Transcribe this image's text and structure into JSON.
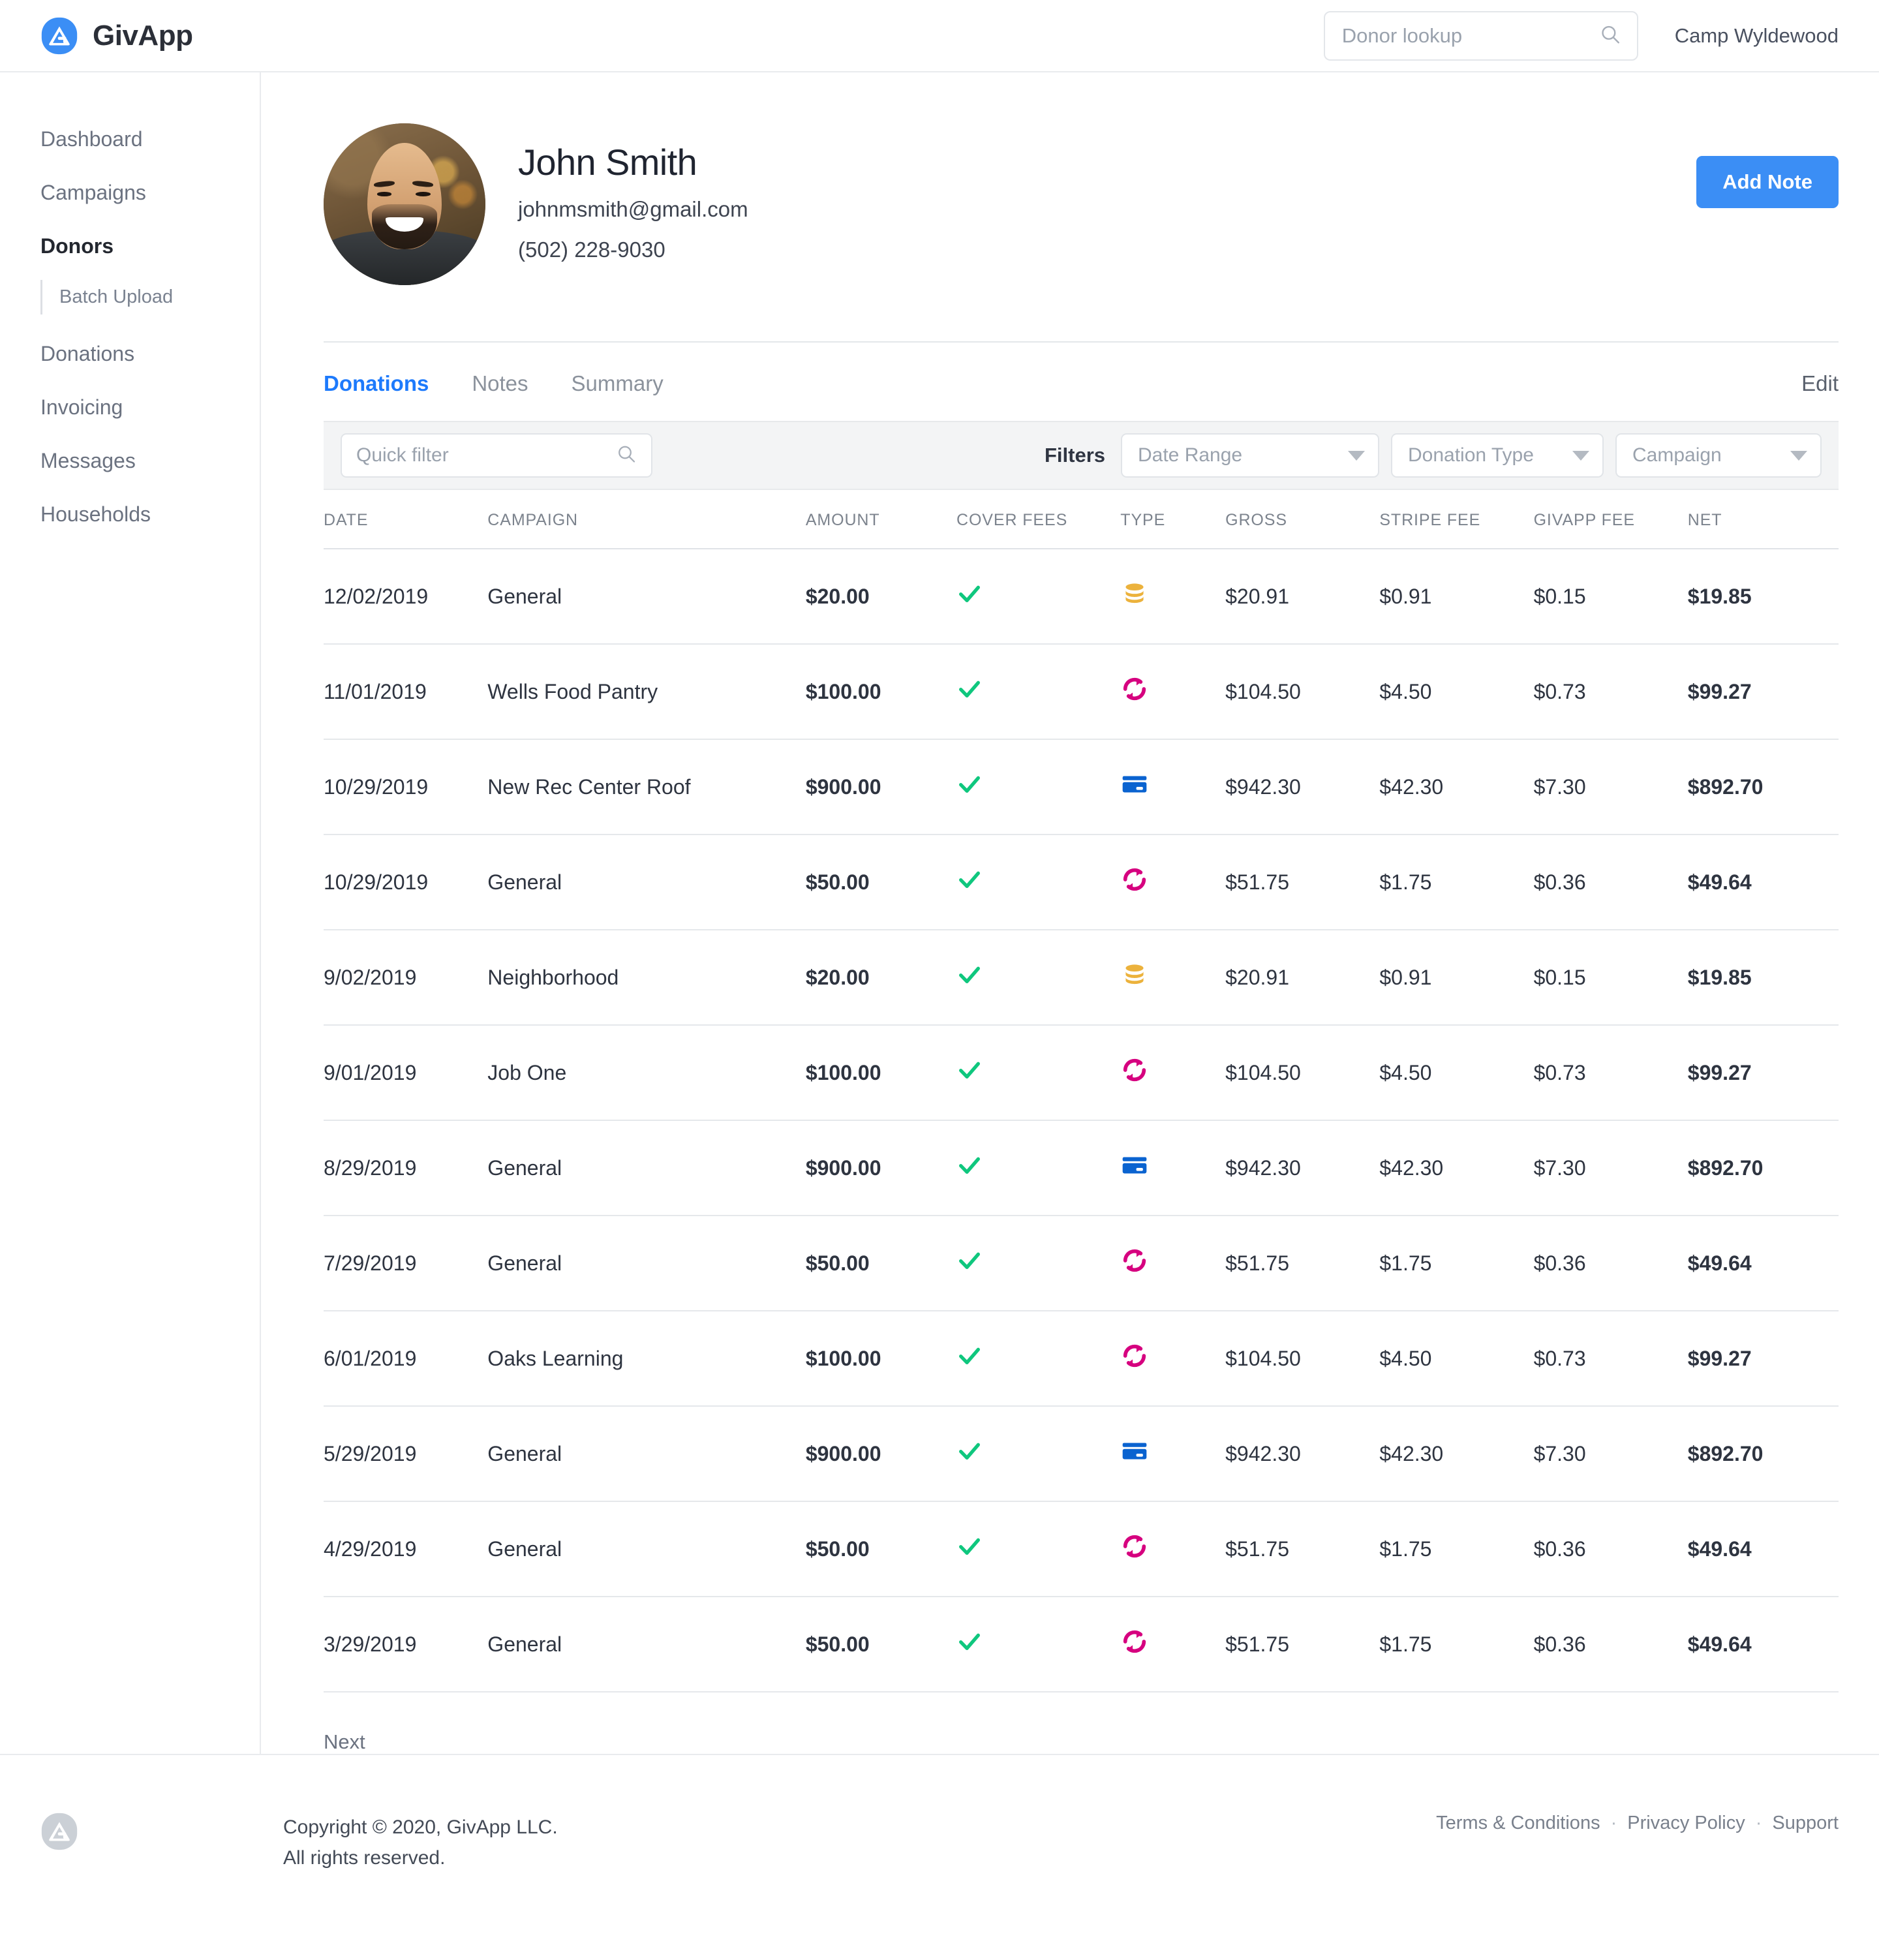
{
  "brand": {
    "name": "GivApp",
    "logo_icon": "givapp-logo-icon"
  },
  "topbar": {
    "lookup_placeholder": "Donor lookup",
    "lookup_value": "",
    "search_icon": "search-icon",
    "org_name": "Camp Wyldewood"
  },
  "sidebar": {
    "items": [
      {
        "label": "Dashboard",
        "active": false
      },
      {
        "label": "Campaigns",
        "active": false
      },
      {
        "label": "Donors",
        "active": true
      }
    ],
    "sub_item": {
      "label": "Batch Upload"
    },
    "items_after": [
      {
        "label": "Donations",
        "active": false
      },
      {
        "label": "Invoicing",
        "active": false
      },
      {
        "label": "Messages",
        "active": false
      },
      {
        "label": "Households",
        "active": false
      }
    ]
  },
  "donor": {
    "name": "John Smith",
    "email": "johnmsmith@gmail.com",
    "phone": "(502) 228-9030",
    "avatar_alt": "donor-avatar"
  },
  "actions": {
    "add_note_label": "Add Note",
    "edit_label": "Edit"
  },
  "tabs": [
    {
      "label": "Donations",
      "active": true
    },
    {
      "label": "Notes",
      "active": false
    },
    {
      "label": "Summary",
      "active": false
    }
  ],
  "filters": {
    "quick_filter_placeholder": "Quick filter",
    "quick_filter_value": "",
    "label": "Filters",
    "selects": [
      {
        "label": "Date Range"
      },
      {
        "label": "Donation Type"
      },
      {
        "label": "Campaign"
      }
    ]
  },
  "table": {
    "columns": [
      "DATE",
      "CAMPAIGN",
      "AMOUNT",
      "COVER FEES",
      "TYPE",
      "GROSS",
      "STRIPE FEE",
      "GIVAPP FEE",
      "NET"
    ],
    "rows": [
      {
        "date": "12/02/2019",
        "campaign": "General",
        "amount": "$20.00",
        "cover_fees": true,
        "type": "cash",
        "gross": "$20.91",
        "stripe_fee": "$0.91",
        "givapp_fee": "$0.15",
        "net": "$19.85"
      },
      {
        "date": "11/01/2019",
        "campaign": "Wells Food Pantry",
        "amount": "$100.00",
        "cover_fees": true,
        "type": "recurring",
        "gross": "$104.50",
        "stripe_fee": "$4.50",
        "givapp_fee": "$0.73",
        "net": "$99.27"
      },
      {
        "date": "10/29/2019",
        "campaign": "New Rec Center Roof",
        "amount": "$900.00",
        "cover_fees": true,
        "type": "card",
        "gross": "$942.30",
        "stripe_fee": "$42.30",
        "givapp_fee": "$7.30",
        "net": "$892.70"
      },
      {
        "date": "10/29/2019",
        "campaign": "General",
        "amount": "$50.00",
        "cover_fees": true,
        "type": "recurring",
        "gross": "$51.75",
        "stripe_fee": "$1.75",
        "givapp_fee": "$0.36",
        "net": "$49.64"
      },
      {
        "date": "9/02/2019",
        "campaign": "Neighborhood",
        "amount": "$20.00",
        "cover_fees": true,
        "type": "cash",
        "gross": "$20.91",
        "stripe_fee": "$0.91",
        "givapp_fee": "$0.15",
        "net": "$19.85"
      },
      {
        "date": "9/01/2019",
        "campaign": "Job One",
        "amount": "$100.00",
        "cover_fees": true,
        "type": "recurring",
        "gross": "$104.50",
        "stripe_fee": "$4.50",
        "givapp_fee": "$0.73",
        "net": "$99.27"
      },
      {
        "date": "8/29/2019",
        "campaign": "General",
        "amount": "$900.00",
        "cover_fees": true,
        "type": "card",
        "gross": "$942.30",
        "stripe_fee": "$42.30",
        "givapp_fee": "$7.30",
        "net": "$892.70"
      },
      {
        "date": "7/29/2019",
        "campaign": "General",
        "amount": "$50.00",
        "cover_fees": true,
        "type": "recurring",
        "gross": "$51.75",
        "stripe_fee": "$1.75",
        "givapp_fee": "$0.36",
        "net": "$49.64"
      },
      {
        "date": "6/01/2019",
        "campaign": "Oaks Learning",
        "amount": "$100.00",
        "cover_fees": true,
        "type": "recurring",
        "gross": "$104.50",
        "stripe_fee": "$4.50",
        "givapp_fee": "$0.73",
        "net": "$99.27"
      },
      {
        "date": "5/29/2019",
        "campaign": "General",
        "amount": "$900.00",
        "cover_fees": true,
        "type": "card",
        "gross": "$942.30",
        "stripe_fee": "$42.30",
        "givapp_fee": "$7.30",
        "net": "$892.70"
      },
      {
        "date": "4/29/2019",
        "campaign": "General",
        "amount": "$50.00",
        "cover_fees": true,
        "type": "recurring",
        "gross": "$51.75",
        "stripe_fee": "$1.75",
        "givapp_fee": "$0.36",
        "net": "$49.64"
      },
      {
        "date": "3/29/2019",
        "campaign": "General",
        "amount": "$50.00",
        "cover_fees": true,
        "type": "recurring",
        "gross": "$51.75",
        "stripe_fee": "$1.75",
        "givapp_fee": "$0.36",
        "net": "$49.64"
      }
    ],
    "next_label": "Next"
  },
  "footer": {
    "logo_icon": "givapp-logo-gray-icon",
    "copyright_line1": "Copyright © 2020, GivApp LLC.",
    "copyright_line2": "All rights reserved.",
    "links": [
      "Terms & Conditions",
      "Privacy Policy",
      "Support"
    ],
    "separator": "·"
  },
  "colors": {
    "accent_blue": "#1d7afc",
    "button_blue": "#3b8ef5",
    "check_green": "#0fc77e",
    "cash_gold": "#ecb23c",
    "recurring_pink": "#d6007f",
    "card_blue": "#0a63d0",
    "filterbar_bg": "#f3f4f5"
  }
}
